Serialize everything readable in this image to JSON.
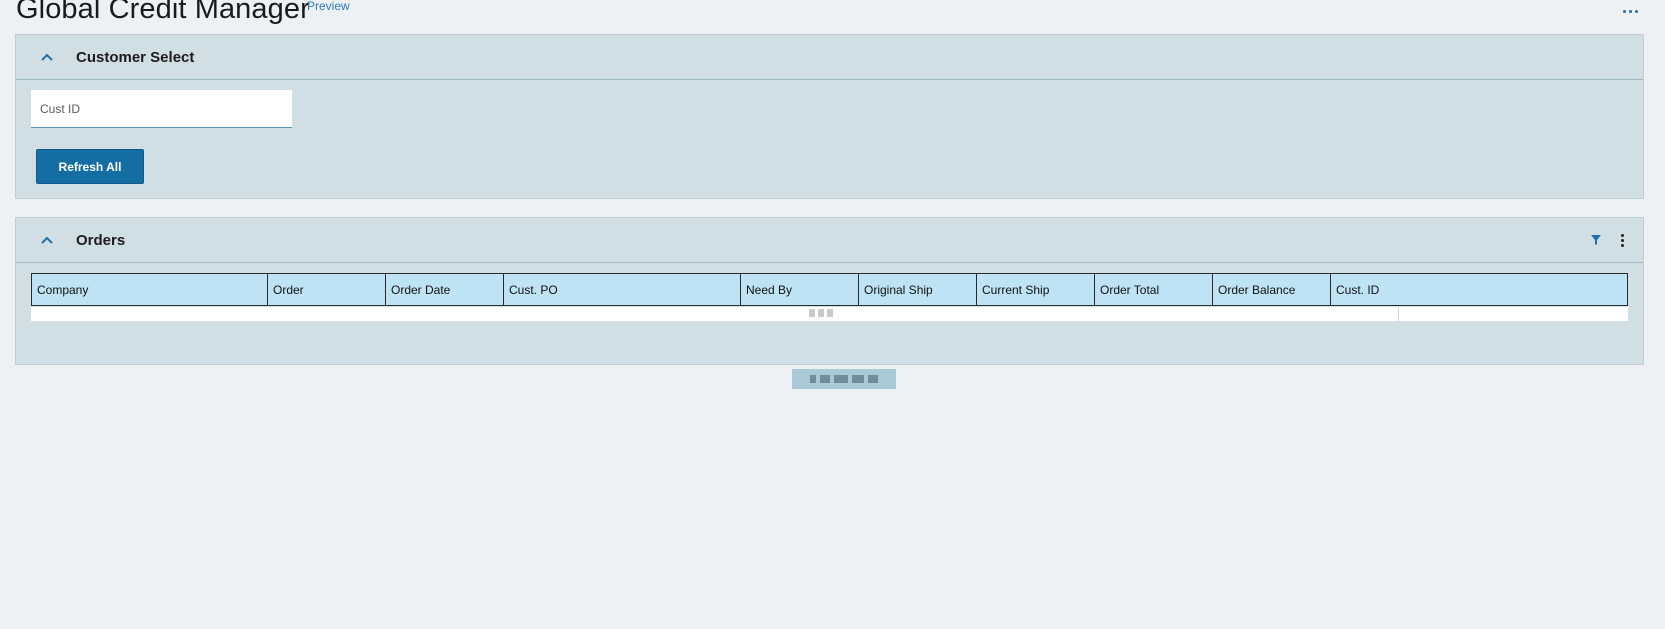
{
  "header": {
    "title": "Global Credit Manager",
    "badge": "Preview",
    "menu_icon": "ellipsis-icon"
  },
  "customer_select": {
    "title": "Customer Select",
    "collapse_icon": "chevron-up-icon",
    "cust_id_placeholder": "Cust ID",
    "cust_id_value": "",
    "refresh_label": "Refresh All"
  },
  "orders": {
    "title": "Orders",
    "collapse_icon": "chevron-up-icon",
    "tools": [
      "filter-icon",
      "kebab-menu-icon"
    ],
    "columns": [
      "Company",
      "Order",
      "Order Date",
      "Cust. PO",
      "Need By",
      "Original Ship",
      "Current Ship",
      "Order Total",
      "Order Balance",
      "Cust. ID"
    ],
    "rows": []
  },
  "colors": {
    "page_bg": "#edf1f4",
    "panel_bg": "#d1dee3",
    "accent": "#146da3",
    "grid_header_bg": "#bee3f5",
    "link": "#2b7bc0"
  }
}
